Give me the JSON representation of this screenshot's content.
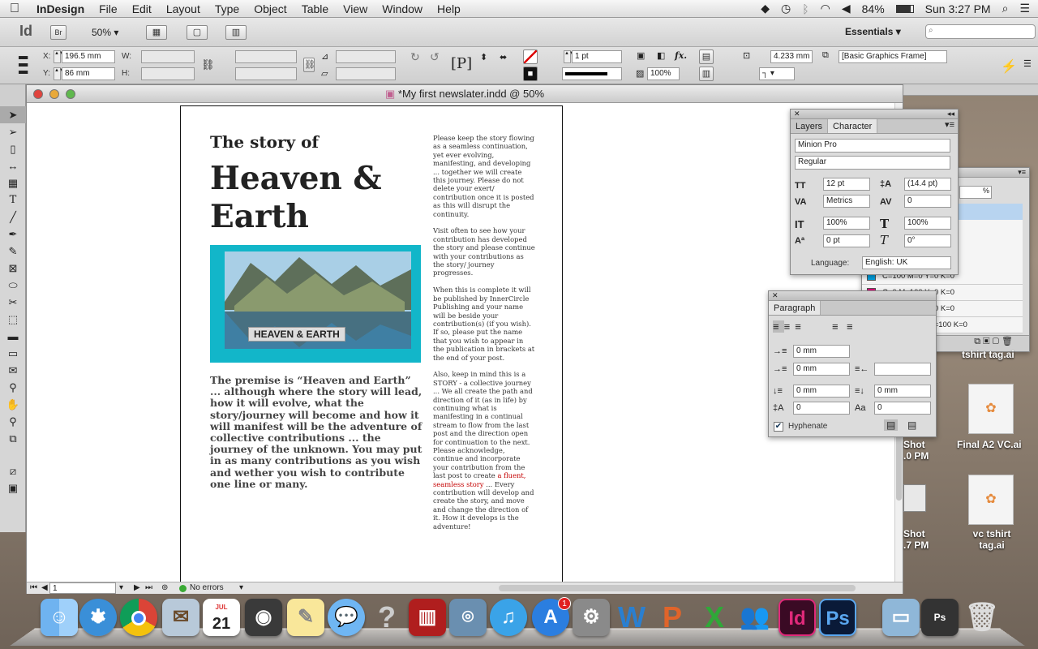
{
  "menubar": {
    "app_name": "InDesign",
    "items": [
      "File",
      "Edit",
      "Layout",
      "Type",
      "Object",
      "Table",
      "View",
      "Window",
      "Help"
    ],
    "battery": "84%",
    "clock": "Sun 3:27 PM"
  },
  "appbar": {
    "logo": "Id",
    "bridge": "Br",
    "zoom": "50%",
    "workspace": "Essentials",
    "search_placeholder": ""
  },
  "control": {
    "x_label": "X:",
    "x_value": "196.5 mm",
    "y_label": "Y:",
    "y_value": "86 mm",
    "w_label": "W:",
    "h_label": "H:",
    "stroke_weight": "1 pt",
    "opacity": "100%",
    "fx": "fx.",
    "frame_width": "4.233 mm",
    "object_style": "[Basic Graphics Frame]"
  },
  "document": {
    "title": "*My first newslater.indd @ 50%",
    "kicker": "The story of",
    "headline": "Heaven & Earth",
    "image_caption": "HEAVEN & EARTH",
    "lede": "The premise is “Heaven and Earth” ... although where the story will lead, how it will evolve, what the story/journey will become and how it will manifest will be the adventure of collective contributions ... the journey of the unknown. You may put in as many contributions as you wish and wether you wish to contribute one line or many.",
    "col_p1": "Please keep the story flowing as a seamless continuation, yet ever evolving, manifesting, and developing ... together we will create this journey. Please do not delete your exert/ contribution once it is posted as this will disrupt the continuity.",
    "col_p2": "Visit often to see how your contribution has developed the story and please continue with your contributions as the story/ journey progresses.",
    "col_p3": "When this is complete it will be published by InnerCircle Publishing and your name will be beside your contribution(s) (if you wish). If so, please put the name that you wish to appear in the publication in brackets at the end of your post.",
    "col_p4a": "Also, keep in mind this is a STORY - a collective journey ... We all create the path and direction of it (as in life) by continuing what is manifesting in a continual stream to flow from the last post and the direction open for continuation to the next. Please acknowledge, continue and incorporate your contribution from the last post to create ",
    "col_p4_red": "a fluent, seamless story",
    "col_p4b": " ... Every contribution will develop and create the story, and move and change the direction of it. How it develops is the adventure!"
  },
  "status": {
    "page": "1",
    "errors": "No errors"
  },
  "character_panel": {
    "tab_layers": "Layers",
    "tab_character": "Character",
    "font_family": "Minion Pro",
    "font_style": "Regular",
    "size": "12 pt",
    "leading": "(14.4 pt)",
    "kerning": "Metrics",
    "tracking": "0",
    "vscale": "100%",
    "hscale": "100%",
    "baseline": "0 pt",
    "skew": "0°",
    "language_label": "Language:",
    "language": "English: UK"
  },
  "paragraph_panel": {
    "tab": "Paragraph",
    "left_indent": "0 mm",
    "first_indent": "0 mm",
    "space_before": "0 mm",
    "space_after": "0 mm",
    "drop_lines": "0",
    "drop_chars": "0",
    "hyphenate": "Hyphenate"
  },
  "swatches": {
    "pct": "%",
    "items": [
      {
        "name": "C=100 M=0 Y=0 K=0",
        "color": "#00a0e0"
      },
      {
        "name": "C=0 M=100 Y=0 K=0",
        "color": "#e0007a"
      },
      {
        "name": "C=0 M=0 Y=100 K=0",
        "color": "#fff200"
      },
      {
        "name": "C=15 M=100 Y=100 K=0",
        "color": "#d0202a"
      }
    ]
  },
  "desktop": {
    "icon1": "tshirt tag.ai",
    "icon2": "Final A2 VC.ai",
    "icon3": "vc tshirt tag.ai",
    "partial1a": "Shot",
    "partial1b": ".0 PM",
    "partial2a": "Shot",
    "partial2b": ".7 PM"
  },
  "dock": {
    "badge": "1",
    "calendar_month": "JUL",
    "calendar_day": "21",
    "id_label": "Id",
    "ps_label": "Ps"
  },
  "colors": {
    "accent": "#12b6c9",
    "red_text": "#c40000",
    "indesign": "#e0297a",
    "photoshop": "#1f4f9a"
  }
}
